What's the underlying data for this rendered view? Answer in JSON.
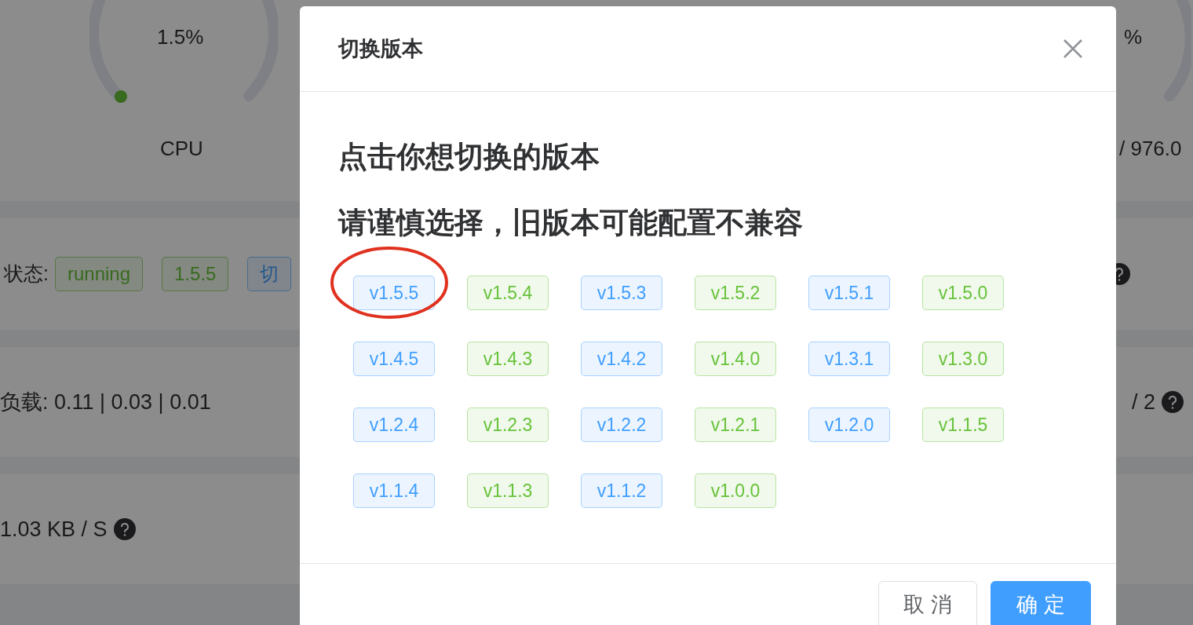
{
  "background": {
    "gauges": [
      {
        "reading": "1.5%",
        "label": "CPU"
      },
      {
        "reading": "%",
        "label": "/ 976.0"
      }
    ],
    "status_row": {
      "label": "状态:",
      "tags": [
        {
          "text": "running",
          "kind": "success"
        },
        {
          "text": "1.5.5",
          "kind": "success"
        },
        {
          "text": "切",
          "kind": "primary"
        }
      ]
    },
    "load_row": {
      "text": "负载: 0.11 | 0.03 | 0.01",
      "right_text": "/ 2"
    },
    "network_row": {
      "text": "1.03 KB / S"
    }
  },
  "dialog": {
    "title": "切换版本",
    "lines": [
      "点击你想切换的版本",
      "请谨慎选择，旧版本可能配置不兼容"
    ],
    "versions": [
      {
        "label": "v1.5.5",
        "color": "#409eff",
        "circled": true
      },
      {
        "label": "v1.5.4",
        "color": "#67c23a",
        "circled": false
      },
      {
        "label": "v1.5.3",
        "color": "#409eff",
        "circled": false
      },
      {
        "label": "v1.5.2",
        "color": "#67c23a",
        "circled": false
      },
      {
        "label": "v1.5.1",
        "color": "#409eff",
        "circled": false
      },
      {
        "label": "v1.5.0",
        "color": "#67c23a",
        "circled": false
      },
      {
        "label": "v1.4.5",
        "color": "#409eff",
        "circled": false
      },
      {
        "label": "v1.4.3",
        "color": "#67c23a",
        "circled": false
      },
      {
        "label": "v1.4.2",
        "color": "#409eff",
        "circled": false
      },
      {
        "label": "v1.4.0",
        "color": "#67c23a",
        "circled": false
      },
      {
        "label": "v1.3.1",
        "color": "#409eff",
        "circled": false
      },
      {
        "label": "v1.3.0",
        "color": "#67c23a",
        "circled": false
      },
      {
        "label": "v1.2.4",
        "color": "#409eff",
        "circled": false
      },
      {
        "label": "v1.2.3",
        "color": "#67c23a",
        "circled": false
      },
      {
        "label": "v1.2.2",
        "color": "#409eff",
        "circled": false
      },
      {
        "label": "v1.2.1",
        "color": "#67c23a",
        "circled": false
      },
      {
        "label": "v1.2.0",
        "color": "#409eff",
        "circled": false
      },
      {
        "label": "v1.1.5",
        "color": "#67c23a",
        "circled": false
      },
      {
        "label": "v1.1.4",
        "color": "#409eff",
        "circled": false
      },
      {
        "label": "v1.1.3",
        "color": "#67c23a",
        "circled": false
      },
      {
        "label": "v1.1.2",
        "color": "#409eff",
        "circled": false
      },
      {
        "label": "v1.0.0",
        "color": "#67c23a",
        "circled": false
      }
    ],
    "buttons": [
      {
        "label": "取 消",
        "kind": "secondary"
      },
      {
        "label": "确 定",
        "kind": "primary"
      }
    ]
  }
}
